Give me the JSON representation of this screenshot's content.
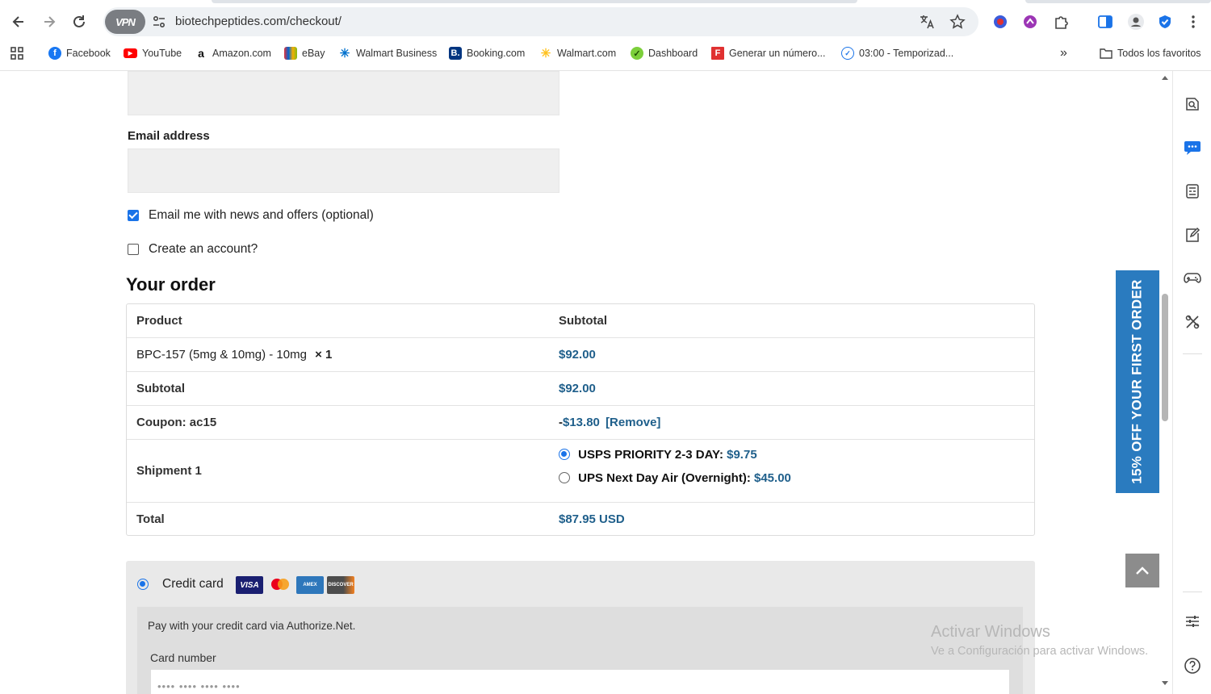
{
  "browser": {
    "url": "biotechpeptides.com/checkout/",
    "vpn_label": "VPN",
    "bookmarks": [
      {
        "label": "Facebook",
        "icon": "facebook-icon"
      },
      {
        "label": "YouTube",
        "icon": "youtube-icon"
      },
      {
        "label": "Amazon.com",
        "icon": "amazon-icon"
      },
      {
        "label": "eBay",
        "icon": "ebay-icon"
      },
      {
        "label": "Walmart Business",
        "icon": "walmart-business-icon"
      },
      {
        "label": "Booking.com",
        "icon": "booking-icon"
      },
      {
        "label": "Walmart.com",
        "icon": "walmart-icon"
      },
      {
        "label": "Dashboard",
        "icon": "dashboard-icon"
      },
      {
        "label": "Generar un número...",
        "icon": "generator-icon"
      },
      {
        "label": "03:00 - Temporizad...",
        "icon": "timer-icon"
      }
    ],
    "all_bookmarks_label": "Todos los favoritos",
    "colors": {
      "accent": "#1a73e8",
      "promo": "#2a7bbf",
      "price": "#1f5f8b"
    }
  },
  "form": {
    "email_label": "Email address",
    "email_value": "",
    "newsletter_label": "Email me with news and offers (optional)",
    "newsletter_checked": true,
    "create_account_label": "Create an account?",
    "create_account_checked": false
  },
  "order": {
    "title": "Your order",
    "header": {
      "product": "Product",
      "subtotal": "Subtotal"
    },
    "item": {
      "name": "BPC-157 (5mg & 10mg) - 10mg",
      "qty": "× 1",
      "price": "$92.00"
    },
    "subtotal": {
      "label": "Subtotal",
      "value": "$92.00"
    },
    "coupon": {
      "label": "Coupon: ac15",
      "minus": "-",
      "value": "$13.80",
      "remove": "[Remove]"
    },
    "shipment": {
      "label": "Shipment 1",
      "options": [
        {
          "label": "USPS PRIORITY 2-3 DAY:",
          "price": "$9.75",
          "selected": true
        },
        {
          "label": "UPS Next Day Air (Overnight):",
          "price": "$45.00",
          "selected": false
        }
      ]
    },
    "total": {
      "label": "Total",
      "value": "$87.95 USD"
    }
  },
  "payment": {
    "method_label": "Credit card",
    "selected": true,
    "cards": [
      "VISA",
      "MC",
      "AMEX",
      "DISCOVER"
    ],
    "description": "Pay with your credit card via Authorize.Net.",
    "card_number_label": "Card number",
    "card_number_placeholder": "•••• •••• •••• ••••"
  },
  "promo": {
    "text": "15% OFF YOUR FIRST ORDER"
  },
  "watermark": {
    "line1": "Activar Windows",
    "line2": "Ve a Configuración para activar Windows."
  }
}
